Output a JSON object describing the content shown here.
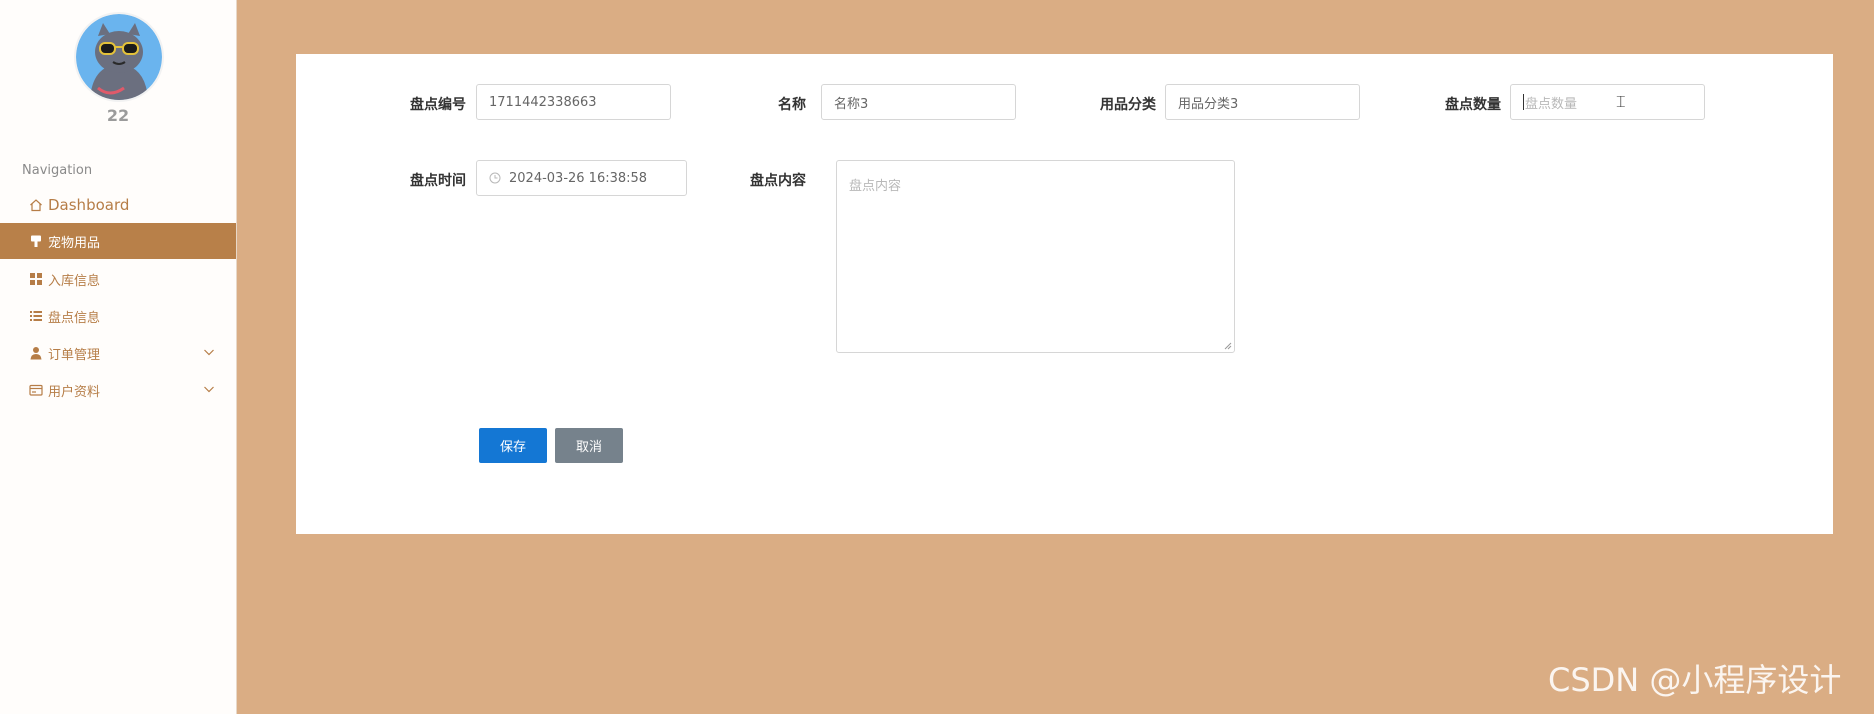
{
  "user": {
    "name": "22"
  },
  "nav": {
    "title": "Navigation",
    "items": [
      {
        "label": "Dashboard",
        "icon": "home-icon"
      },
      {
        "label": "宠物用品",
        "icon": "brush-icon"
      },
      {
        "label": "入库信息",
        "icon": "grid-icon"
      },
      {
        "label": "盘点信息",
        "icon": "list-icon"
      },
      {
        "label": "订单管理",
        "icon": "person-icon"
      },
      {
        "label": "用户资料",
        "icon": "card-icon"
      }
    ],
    "active_index": 1
  },
  "form": {
    "code_label": "盘点编号",
    "code_value": "1711442338663",
    "name_label": "名称",
    "name_value": "名称3",
    "category_label": "用品分类",
    "category_value": "用品分类3",
    "quantity_label": "盘点数量",
    "quantity_placeholder": "盘点数量",
    "time_label": "盘点时间",
    "time_value": "2024-03-26 16:38:58",
    "content_label": "盘点内容",
    "content_placeholder": "盘点内容"
  },
  "buttons": {
    "save": "保存",
    "cancel": "取消"
  },
  "watermark": "CSDN @小程序设计",
  "colors": {
    "accent": "#b88049",
    "background": "#daad84",
    "save": "#1477d4",
    "cancel": "#76828c"
  }
}
